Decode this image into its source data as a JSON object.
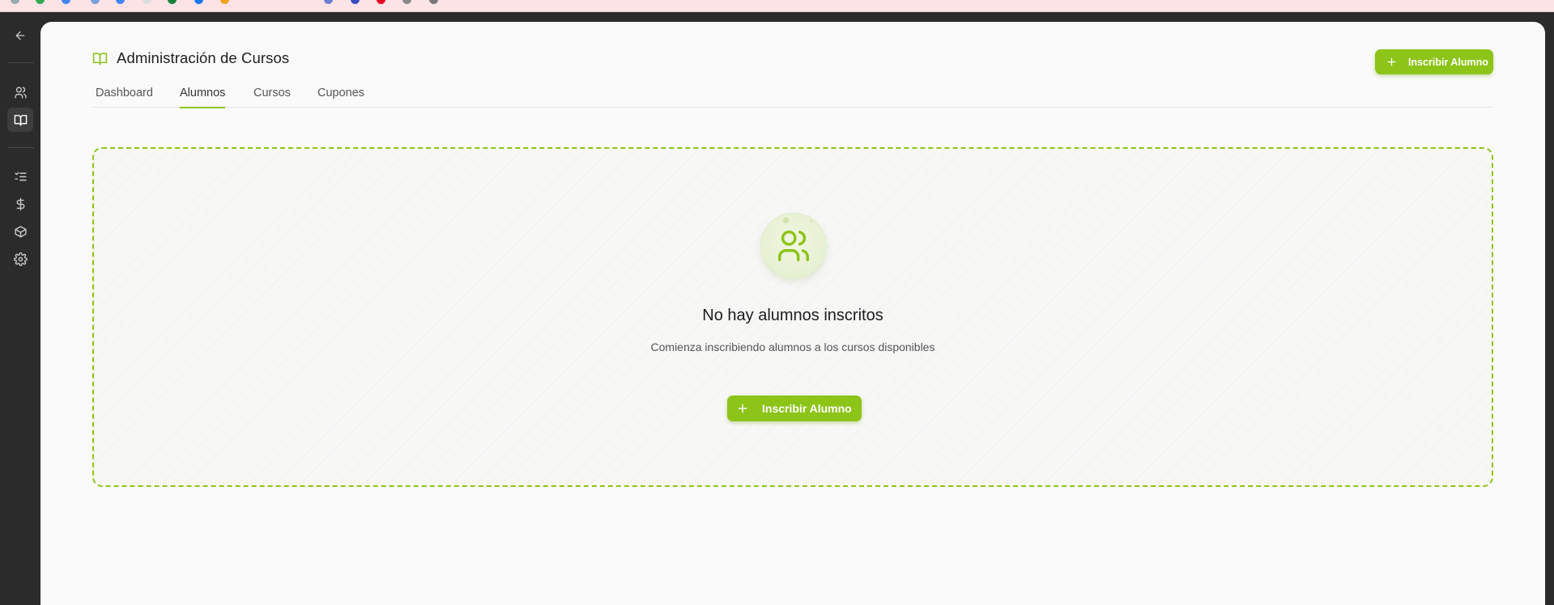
{
  "page": {
    "title": "Administración de Cursos",
    "enroll_button_label": "Inscribir Alumno"
  },
  "rail": {
    "items": [
      {
        "icon": "arrow-left-icon"
      },
      {
        "icon": "users-icon"
      },
      {
        "icon": "book-open-icon",
        "active": true
      },
      {
        "icon": "list-checks-icon"
      },
      {
        "icon": "dollar-icon"
      },
      {
        "icon": "package-icon"
      },
      {
        "icon": "gear-icon"
      }
    ]
  },
  "tabs": [
    {
      "label": "Dashboard"
    },
    {
      "label": "Alumnos",
      "active": true
    },
    {
      "label": "Cursos"
    },
    {
      "label": "Cupones"
    }
  ],
  "empty_state": {
    "icon": "users-icon",
    "title": "No hay alumnos inscritos",
    "subtitle": "Comienza inscribiendo alumnos a los cursos disponibles",
    "button_label": "Inscribir Alumno"
  },
  "colors": {
    "accent": "#8cc418",
    "rail_bg": "#2b2b2b",
    "panel_bg": "#fafafa"
  }
}
